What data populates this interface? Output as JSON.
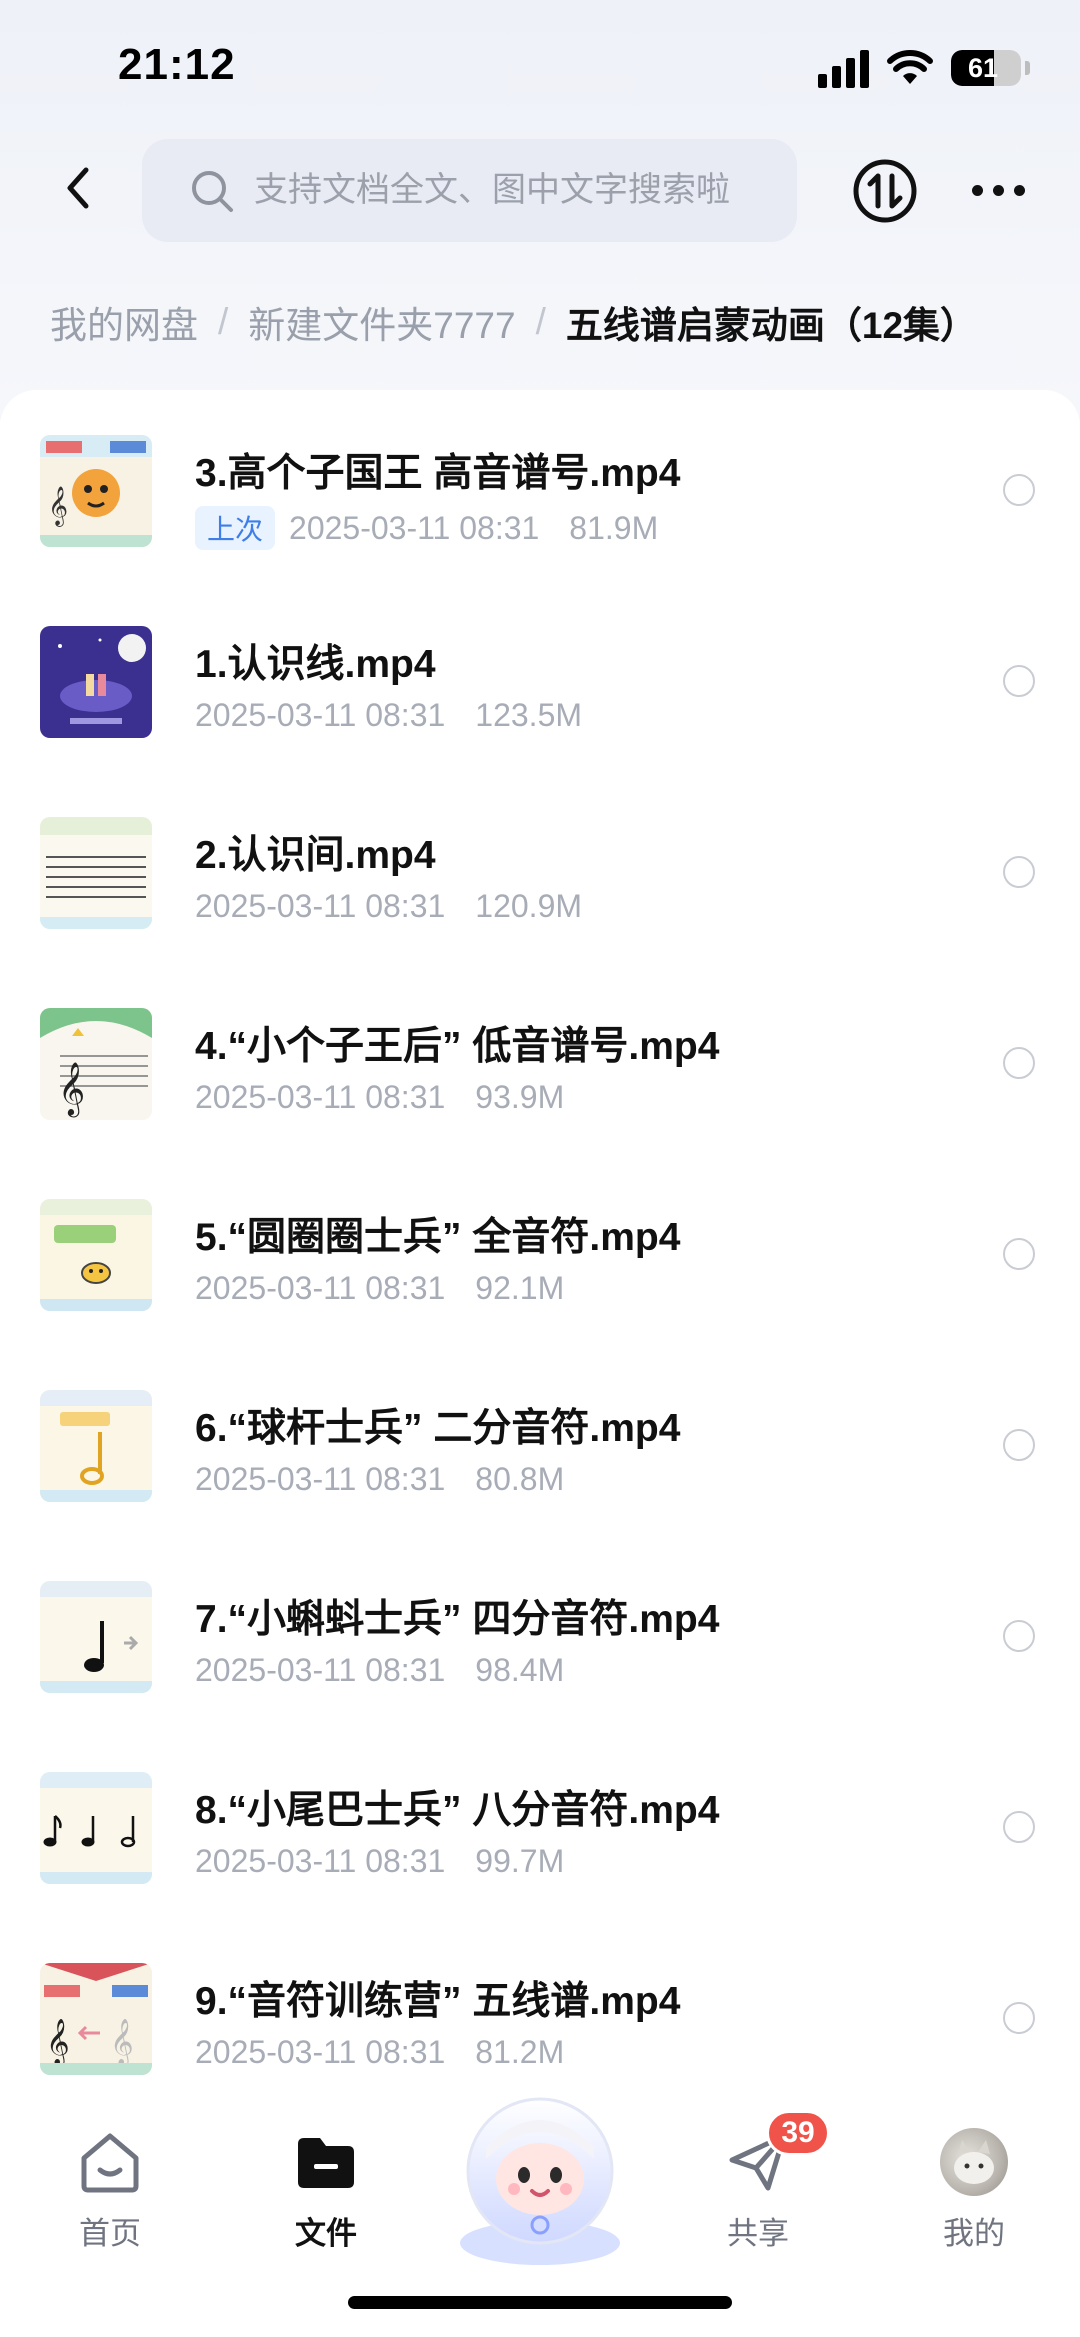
{
  "status_bar": {
    "time": "21:12",
    "battery": "61",
    "battery_level": 0.61
  },
  "header": {
    "search_placeholder": "支持文档全文、图中文字搜索啦"
  },
  "breadcrumb": {
    "items": [
      "我的网盘",
      "新建文件夹7777"
    ],
    "separator": "/",
    "current": "五线谱启蒙动画（12集）"
  },
  "files": [
    {
      "name": "3.高个子国王 高音谱号.mp4",
      "badge": "上次",
      "date": "2025-03-11 08:31",
      "size": "81.9M",
      "thumb": "tiger-clef"
    },
    {
      "name": "1.认识线.mp4",
      "badge": "",
      "date": "2025-03-11 08:31",
      "size": "123.5M",
      "thumb": "night-stage"
    },
    {
      "name": "2.认识间.mp4",
      "badge": "",
      "date": "2025-03-11 08:31",
      "size": "120.9M",
      "thumb": "staff-lines"
    },
    {
      "name": "4.“小个子王后” 低音谱号.mp4",
      "badge": "",
      "date": "2025-03-11 08:31",
      "size": "93.9M",
      "thumb": "bass-clef"
    },
    {
      "name": "5.“圆圈圈士兵” 全音符.mp4",
      "badge": "",
      "date": "2025-03-11 08:31",
      "size": "92.1M",
      "thumb": "whole-note"
    },
    {
      "name": "6.“球杆士兵” 二分音符.mp4",
      "badge": "",
      "date": "2025-03-11 08:31",
      "size": "80.8M",
      "thumb": "half-note"
    },
    {
      "name": "7.“小蝌蚪士兵” 四分音符.mp4",
      "badge": "",
      "date": "2025-03-11 08:31",
      "size": "98.4M",
      "thumb": "quarter-note"
    },
    {
      "name": "8.“小尾巴士兵” 八分音符.mp4",
      "badge": "",
      "date": "2025-03-11 08:31",
      "size": "99.7M",
      "thumb": "eighth-notes"
    },
    {
      "name": "9.“音符训练营” 五线谱.mp4",
      "badge": "",
      "date": "2025-03-11 08:31",
      "size": "81.2M",
      "thumb": "treble-camp"
    }
  ],
  "bottom_nav": {
    "home": "首页",
    "files": "文件",
    "share": "共享",
    "share_badge": "39",
    "me": "我的"
  },
  "colors": {
    "accent_blue": "#3d7ee8",
    "badge_red": "#f0534a"
  }
}
